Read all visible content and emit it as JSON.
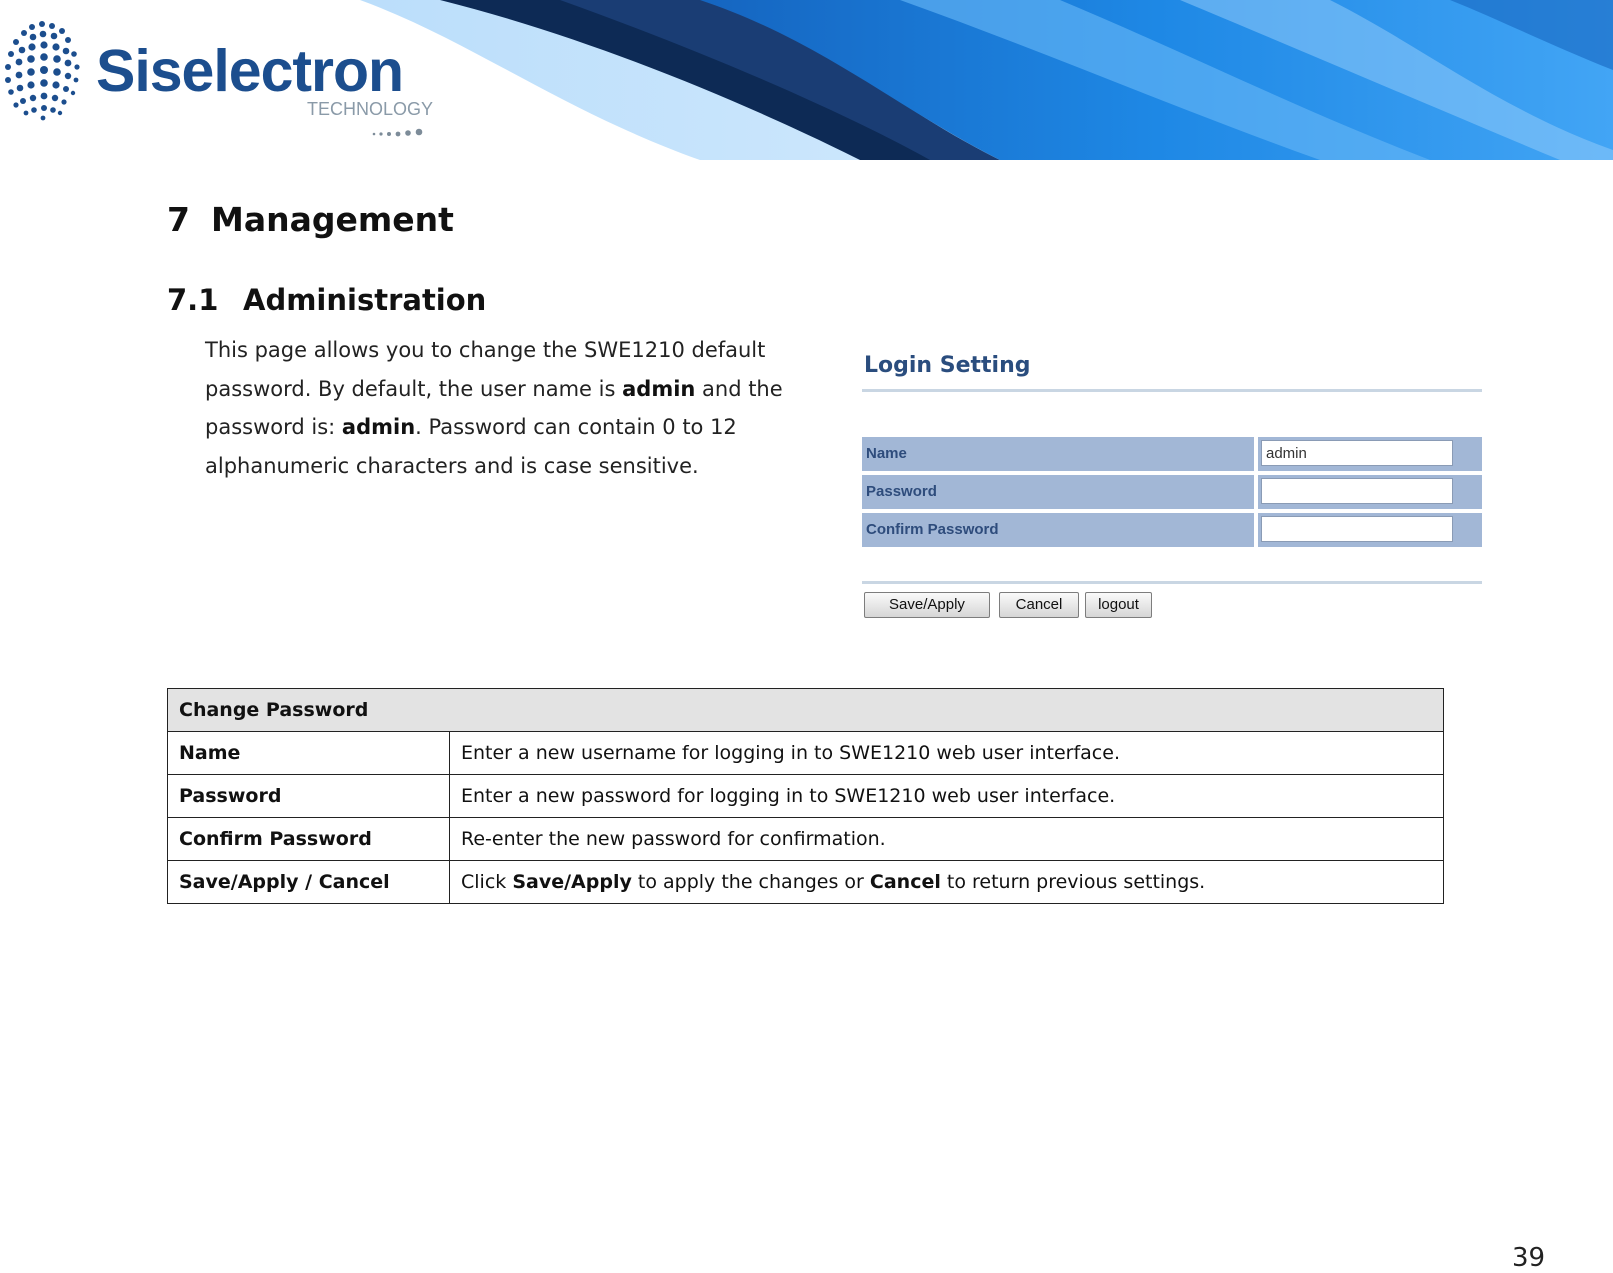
{
  "header": {
    "logo_name": "Siselectron",
    "logo_sub": "TECHNOLOGY",
    "logo_icon": "dotted-globe-icon",
    "banner_colors": [
      "#0a1f3c",
      "#1e88e5",
      "#64b5f6"
    ]
  },
  "section": {
    "number": "7",
    "title": "Management"
  },
  "subsection": {
    "number": "7.1",
    "title": "Administration"
  },
  "intro": {
    "t1": "This page allows you to change the SWE1210 default password. By default, the user name is ",
    "b1": "admin",
    "t2": " and the password is: ",
    "b2": "admin",
    "t3": ". Password can contain 0 to 12 alphanumeric characters and is case sensitive."
  },
  "login_setting": {
    "title": "Login Setting",
    "rows": [
      {
        "label": "Name",
        "value": "admin"
      },
      {
        "label": "Password",
        "value": ""
      },
      {
        "label": "Confirm Password",
        "value": ""
      }
    ],
    "buttons": {
      "save_apply": "Save/Apply",
      "cancel": "Cancel",
      "logout": "logout"
    },
    "colors": {
      "label_bg": "#a2b7d6",
      "title": "#2a4d7e"
    }
  },
  "table": {
    "header": "Change Password",
    "rows": [
      {
        "term": "Name",
        "desc": "Enter a new username for logging in to SWE1210 web user interface."
      },
      {
        "term": "Password",
        "desc": "Enter a new password for logging in to SWE1210 web user interface."
      },
      {
        "term": "Confirm Password",
        "desc": "Re-enter the new password for confirmation."
      },
      {
        "term": "Save/Apply / Cancel",
        "desc_pre": "Click ",
        "desc_b1": "Save/Apply",
        "desc_mid": " to apply the changes or ",
        "desc_b2": "Cancel",
        "desc_post": " to return previous settings."
      }
    ]
  },
  "page_number": "39"
}
